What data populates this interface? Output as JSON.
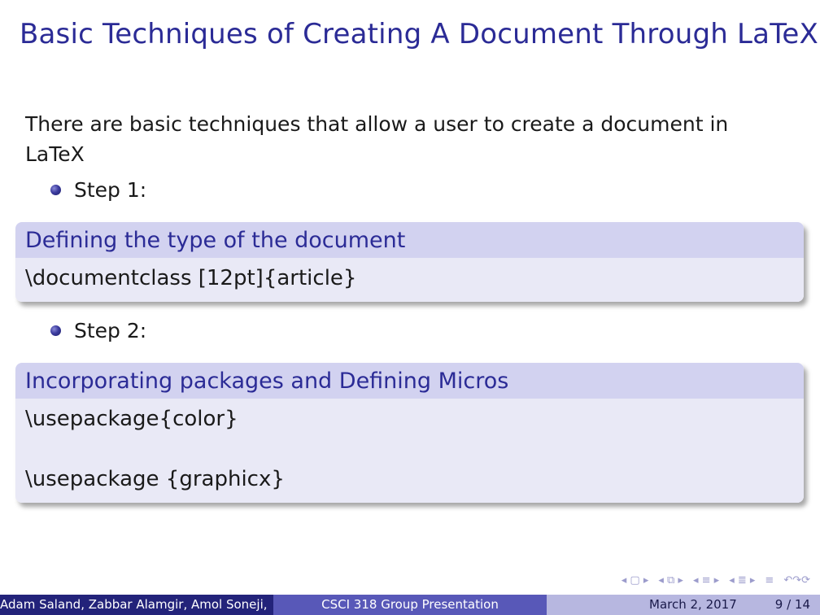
{
  "slide": {
    "title": "Basic Techniques of Creating A Document Through LaTeX",
    "intro": "There are basic techniques that allow a user to create a document in LaTeX",
    "step1": "Step 1:",
    "block1": {
      "title": "Defining the type of the document",
      "line1": "\\documentclass [12pt]{article}"
    },
    "step2": "Step 2:",
    "block2": {
      "title": "Incorporating packages and Defining Micros",
      "line1": "\\usepackage{color}",
      "line2": "\\usepackage {graphicx}"
    }
  },
  "nav": {
    "symbols": [
      "◂ ▢ ▸",
      "◂ ⧉ ▸",
      "◂ ≡ ▸",
      "◂ ≣ ▸",
      "≡",
      "↶↷⟳"
    ]
  },
  "footer": {
    "authors": "Adam Saland, Zabbar Alamgir, Amol Soneji,",
    "presentation": "CSCI 318 Group Presentation",
    "date": "March 2, 2017",
    "page": "9 / 14"
  },
  "colors": {
    "title": "#2b2b96",
    "block_head": "#d2d2f0",
    "block_body": "#e9e9f6",
    "footer_dark": "#23237a",
    "footer_mid": "#5858b8",
    "footer_light": "#b7b7e0"
  }
}
